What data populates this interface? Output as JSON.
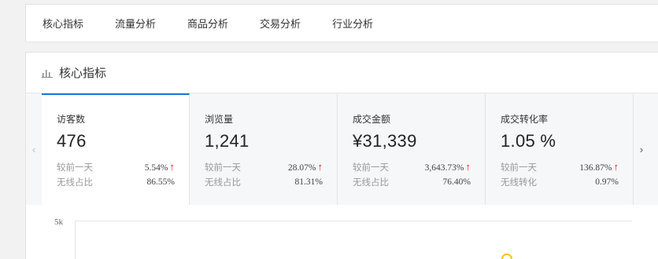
{
  "top_tabs": [
    "核心指标",
    "流量分析",
    "商品分析",
    "交易分析",
    "行业分析"
  ],
  "panel": {
    "title": "核心指标"
  },
  "cards": [
    {
      "label": "访客数",
      "value": "476",
      "compare_label": "较前一天",
      "compare_value": "5.54%",
      "secondary_label": "无线占比",
      "secondary_value": "86.55%"
    },
    {
      "label": "浏览量",
      "value": "1,241",
      "compare_label": "较前一天",
      "compare_value": "28.07%",
      "secondary_label": "无线占比",
      "secondary_value": "81.31%"
    },
    {
      "label": "成交金额",
      "value": "¥31,339",
      "compare_label": "较前一天",
      "compare_value": "3,643.73%",
      "secondary_label": "无线占比",
      "secondary_value": "76.40%"
    },
    {
      "label": "成交转化率",
      "value": "1.05 %",
      "compare_label": "较前一天",
      "compare_value": "136.87%",
      "secondary_label": "无线转化",
      "secondary_value": "0.97%"
    }
  ],
  "arrows": {
    "left": "‹",
    "right": "›",
    "up": "↑"
  },
  "chart": {
    "y_tick": "5k"
  },
  "colors": {
    "accent": "#1877d8",
    "up": "#e02020",
    "series_marker": "#f5c518"
  }
}
